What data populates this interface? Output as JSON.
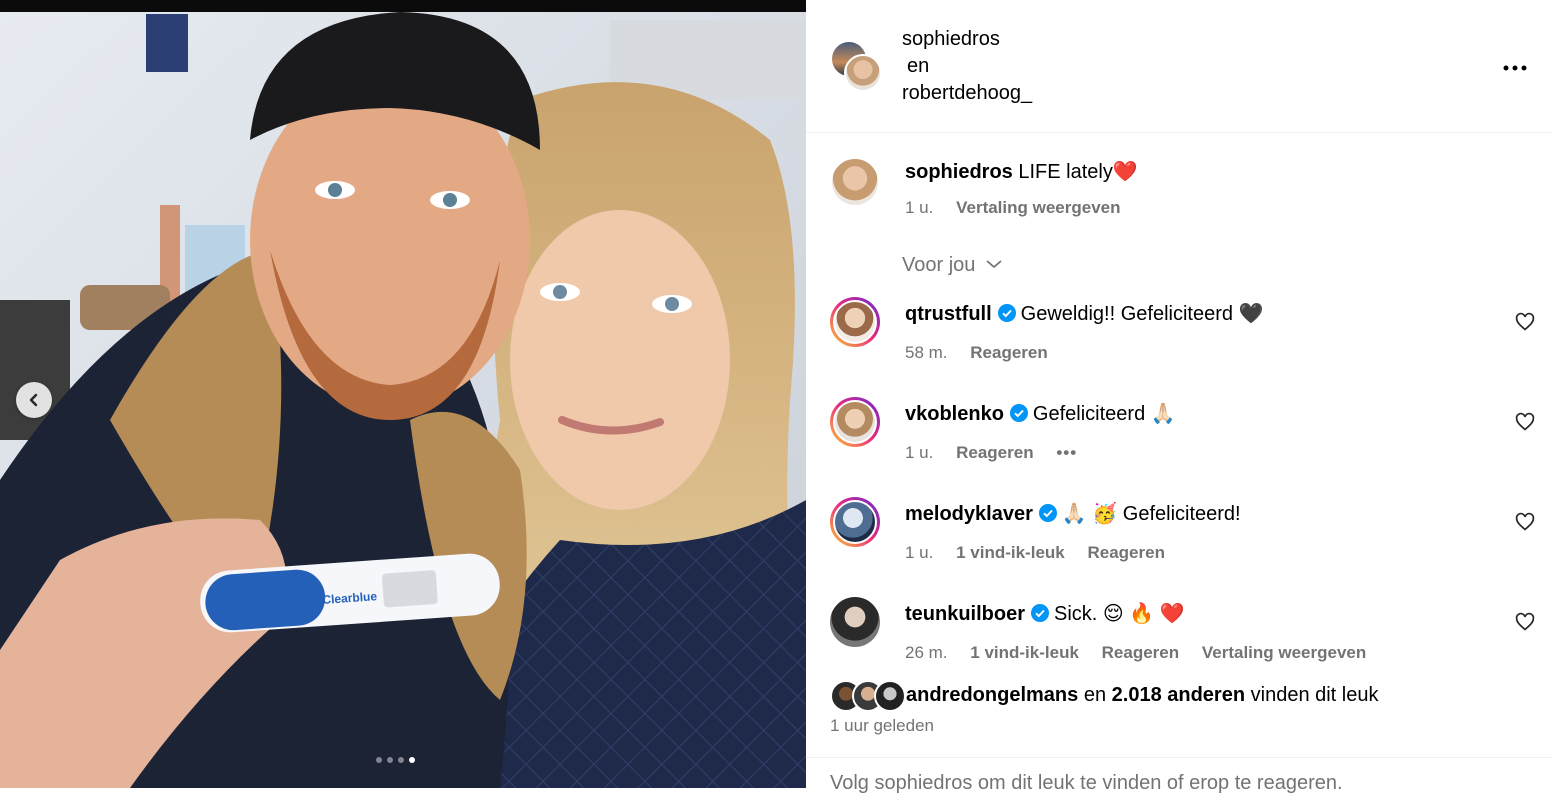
{
  "post": {
    "nav": {
      "prev_icon": "chevron-left-icon"
    },
    "carousel": {
      "total": 4,
      "active": 4
    }
  },
  "header": {
    "user1": "sophiedros",
    "conj": "en",
    "user2": "robertdehoog_",
    "more_icon": "more-horizontal-icon"
  },
  "caption": {
    "user": "sophiedros",
    "text": "LIFE lately",
    "emoji": "❤️",
    "time": "1 u.",
    "translate": "Vertaling weergeven"
  },
  "section": {
    "label": "Voor jou"
  },
  "comments": [
    {
      "user": "qtrustfull",
      "text": "Geweldig!! Gefeliciteerd 🖤",
      "time": "58 m.",
      "likes": "",
      "reply": "Reageren",
      "translate": "",
      "more": ""
    },
    {
      "user": "vkoblenko",
      "text": "Gefeliciteerd 🙏🏻",
      "time": "1 u.",
      "likes": "",
      "reply": "Reageren",
      "translate": "",
      "more": "•••"
    },
    {
      "user": "melodyklaver",
      "text": "🙏🏻 🥳  Gefeliciteerd!",
      "time": "1 u.",
      "likes": "1 vind-ik-leuk",
      "reply": "Reageren",
      "translate": "",
      "more": ""
    },
    {
      "user": "teunkuilboer",
      "text": "Sick. 😌 🔥 ❤️",
      "time": "26 m.",
      "likes": "1 vind-ik-leuk",
      "reply": "Reageren",
      "translate": "Vertaling weergeven",
      "more": ""
    }
  ],
  "likes": {
    "user": "andredongelmans",
    "mid": "en",
    "count": "2.018 anderen",
    "tail": "vinden dit leuk"
  },
  "timestamp": "1 uur geleden",
  "footer": "Volg sophiedros om dit leuk te vinden of erop te reageren.",
  "colors": {
    "verified": "#0095f6",
    "meta": "#737373",
    "ring_start": "#f9ce34",
    "ring_end": "#6228d7"
  }
}
